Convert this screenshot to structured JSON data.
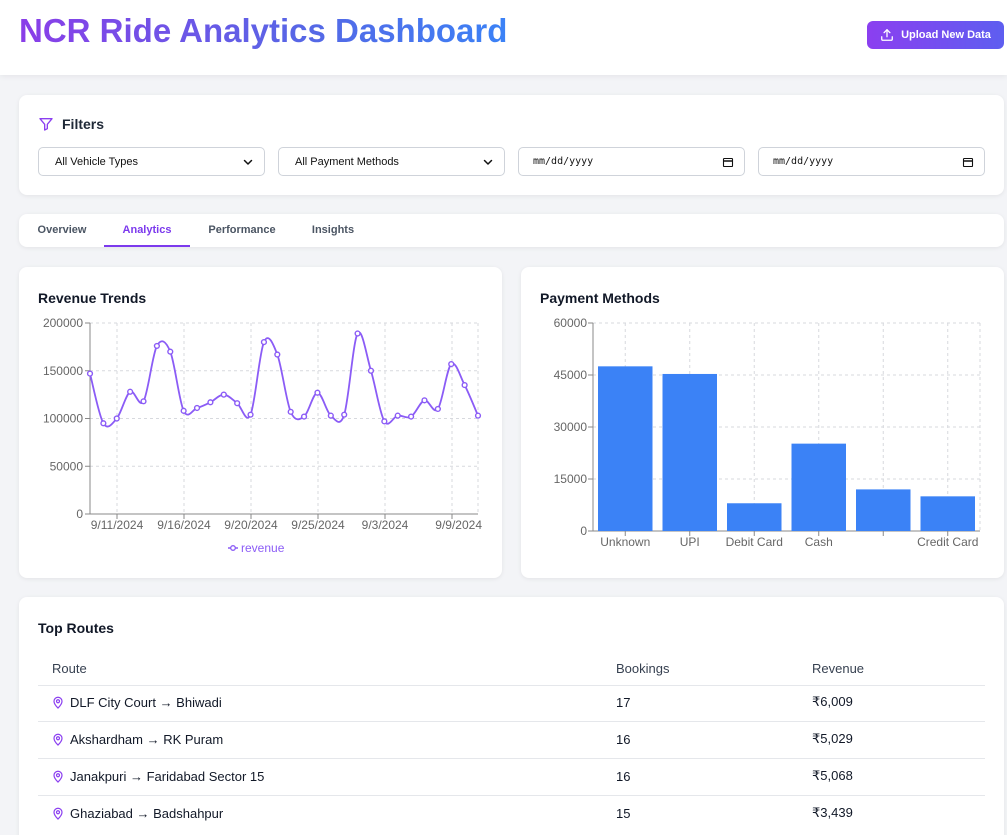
{
  "header": {
    "title": "NCR Ride Analytics Dashboard",
    "upload_label": "Upload New Data"
  },
  "filters": {
    "title": "Filters",
    "vehicle_select": "All Vehicle Types",
    "payment_select": "All Payment Methods",
    "date_from_placeholder": "mm/dd/yyyy",
    "date_to_placeholder": "mm/dd/yyyy"
  },
  "tabs": [
    {
      "label": "Overview"
    },
    {
      "label": "Analytics"
    },
    {
      "label": "Performance"
    },
    {
      "label": "Insights"
    }
  ],
  "colors": {
    "accent": "#7c3aed",
    "line": "#8b5cf6",
    "bar": "#3b82f6"
  },
  "chart_data": [
    {
      "type": "line",
      "title": "Revenue Trends",
      "series": [
        {
          "name": "revenue",
          "values": [
            147000,
            95000,
            100000,
            128000,
            118000,
            176000,
            170000,
            108000,
            111000,
            117000,
            125000,
            116000,
            104000,
            180000,
            167000,
            107000,
            102000,
            127000,
            103000,
            104000,
            189000,
            150000,
            97000,
            103000,
            102000,
            119000,
            110000,
            157000,
            135000,
            103000
          ]
        }
      ],
      "x_tick_labels": [
        "9/11/2024",
        "9/16/2024",
        "9/20/2024",
        "9/25/2024",
        "9/3/2024",
        "9/9/2024"
      ],
      "ylim": [
        0,
        200000
      ],
      "y_ticks": [
        0,
        50000,
        100000,
        150000,
        200000
      ],
      "grid": true,
      "legend": "bottom"
    },
    {
      "type": "bar",
      "title": "Payment Methods",
      "categories": [
        "Unknown",
        "UPI",
        "Debit Card",
        "Cash",
        "",
        "Credit Card"
      ],
      "values": [
        47500,
        45300,
        8000,
        25200,
        12000,
        10000
      ],
      "ylim": [
        0,
        60000
      ],
      "y_ticks": [
        0,
        15000,
        30000,
        45000,
        60000
      ],
      "grid": true
    }
  ],
  "routes": {
    "title": "Top Routes",
    "columns": [
      "Route",
      "Bookings",
      "Revenue"
    ],
    "rows": [
      {
        "route": "DLF City Court → Bhiwadi",
        "bookings": "17",
        "revenue": "₹6,009"
      },
      {
        "route": "Akshardham → RK Puram",
        "bookings": "16",
        "revenue": "₹5,029"
      },
      {
        "route": "Janakpuri → Faridabad Sector 15",
        "bookings": "16",
        "revenue": "₹5,068"
      },
      {
        "route": "Ghaziabad → Badshahpur",
        "bookings": "15",
        "revenue": "₹3,439"
      }
    ]
  }
}
